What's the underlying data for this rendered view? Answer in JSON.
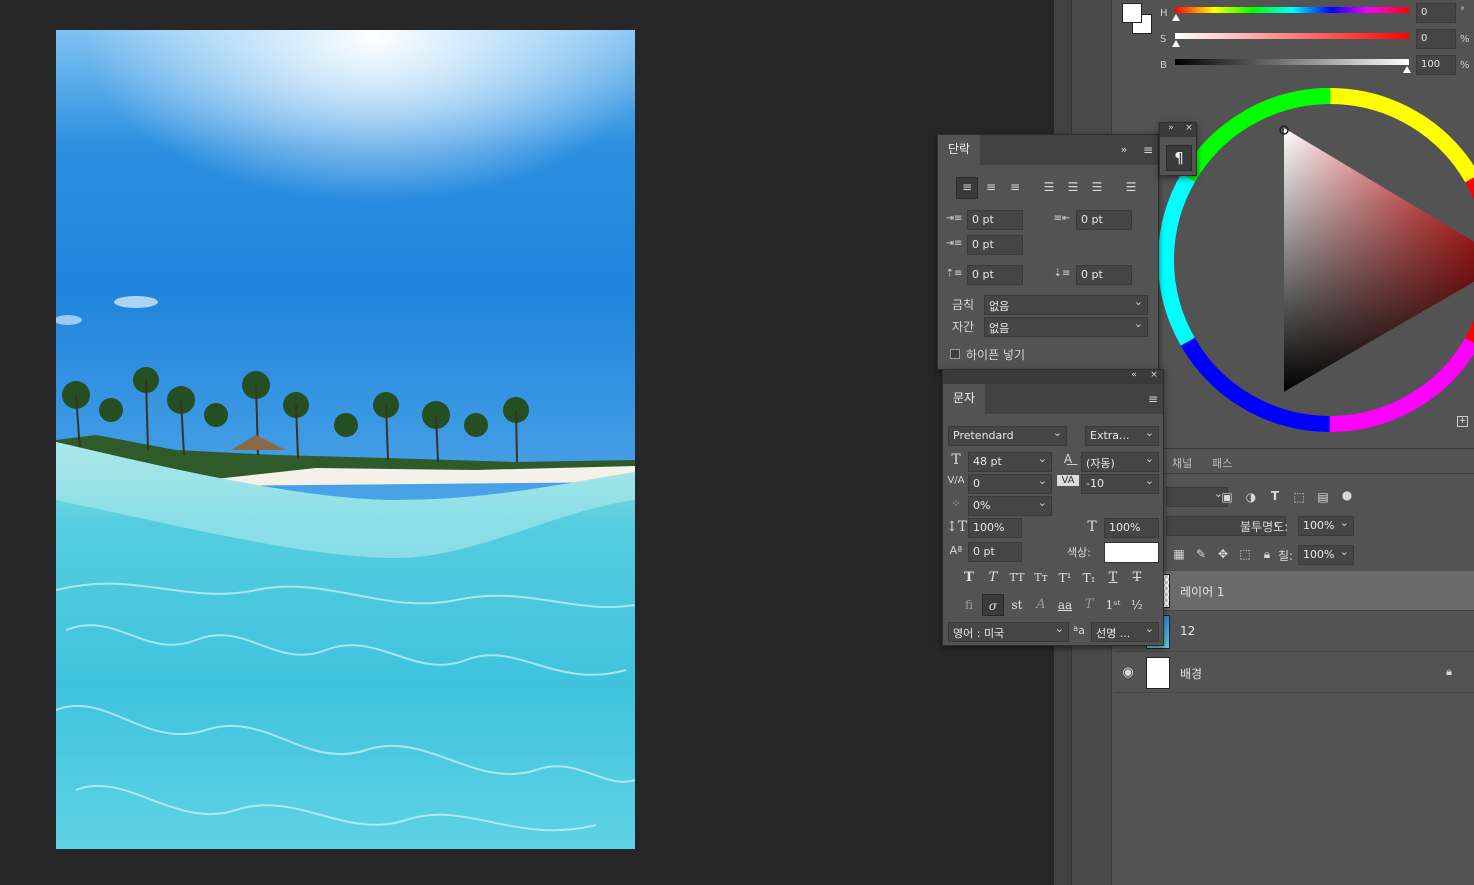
{
  "color_picker": {
    "h_label": "H",
    "s_label": "S",
    "b_label": "B",
    "h_value": "0",
    "s_value": "0",
    "b_value": "100",
    "h_unit": "°",
    "s_unit": "%",
    "b_unit": "%"
  },
  "paragraph_panel": {
    "tab": "단락",
    "indent_left": "0 pt",
    "indent_right": "0 pt",
    "indent_first": "0 pt",
    "space_before": "0 pt",
    "space_after": "0 pt",
    "kinsoku_label": "금칙",
    "kinsoku_value": "없음",
    "mojikumi_label": "자간",
    "mojikumi_value": "없음",
    "hyphenate_label": "하이픈 넣기"
  },
  "character_panel": {
    "tab": "문자",
    "font_family": "Pretendard",
    "font_style": "Extra...",
    "font_size": "48 pt",
    "leading": "(자동)",
    "kerning": "0",
    "tracking": "-10",
    "tsume": "0%",
    "vertical_scale": "100%",
    "horizontal_scale": "100%",
    "baseline_shift": "0 pt",
    "color_label": "색상:",
    "language": "영어 : 미국",
    "aa_label": "a",
    "antialias": "선명 ..."
  },
  "layers_panel": {
    "tabs": [
      "채널",
      "패스"
    ],
    "opacity_label": "불투명도:",
    "opacity_value": "100%",
    "fill_label": "칠:",
    "fill_value": "100%",
    "layers": [
      {
        "name": "레이어 1"
      },
      {
        "name": "12"
      },
      {
        "name": "배경"
      }
    ]
  },
  "colors": {
    "ui_bg": "#535353",
    "workspace": "#272727",
    "foreground_color": "#ffffff"
  }
}
